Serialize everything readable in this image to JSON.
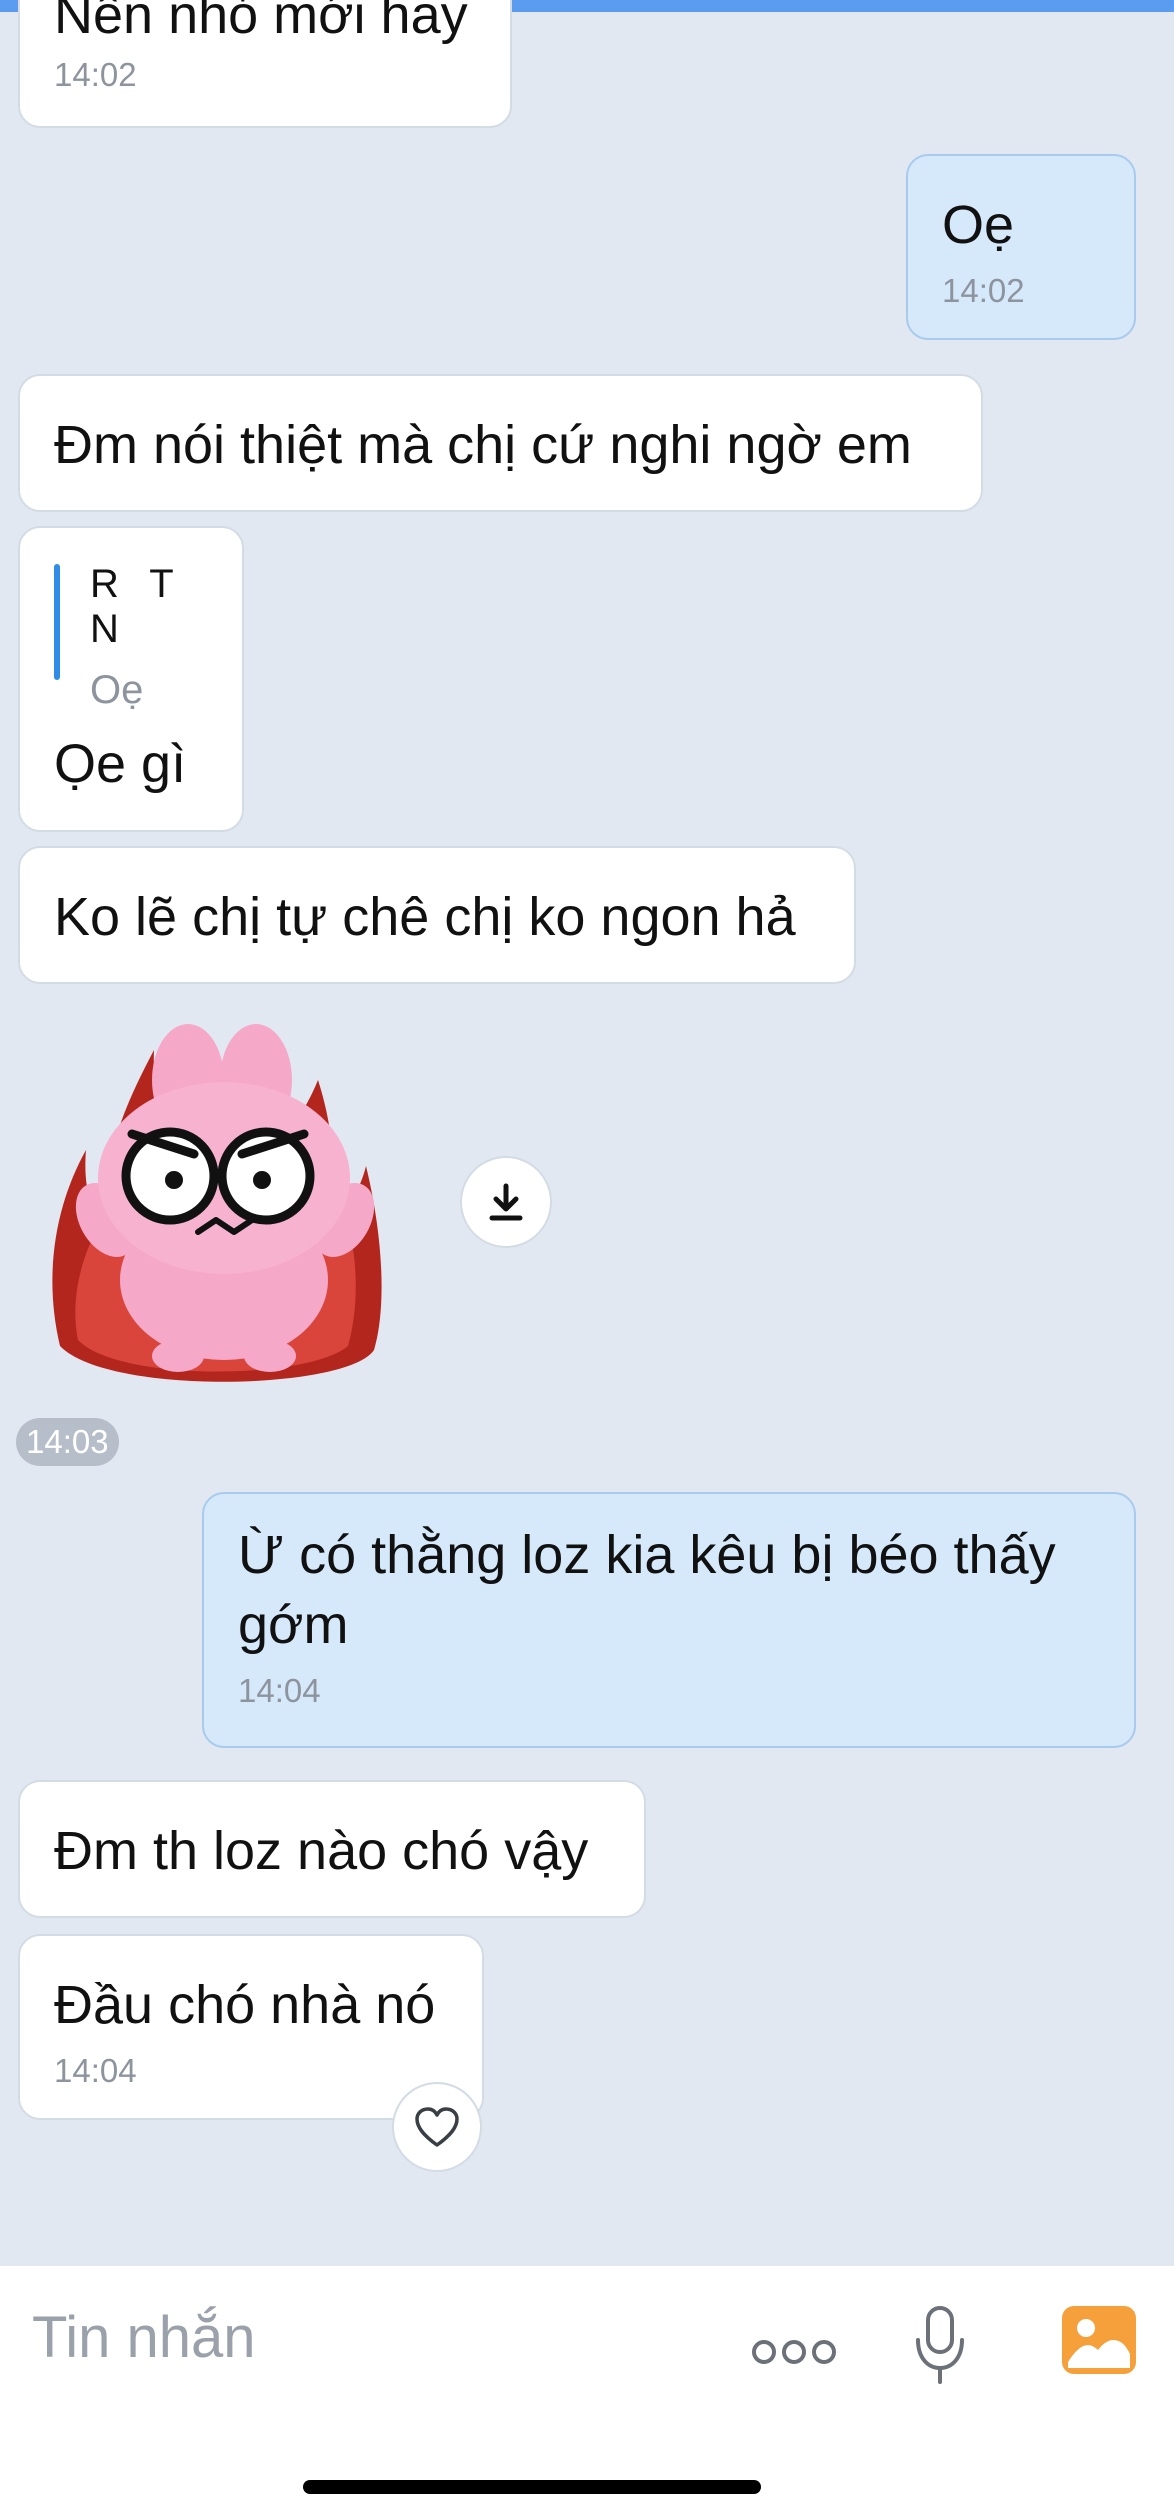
{
  "messages": [
    {
      "text": "Nên nhỏ mới hay",
      "time": "14:02"
    },
    {
      "text": "Oẹ",
      "time": "14:02"
    },
    {
      "text": "Đm nói thiệt mà chị cứ nghi ngờ em"
    },
    {
      "reply_author": "R T N",
      "reply_text": "Oẹ",
      "text": "Ọe gì"
    },
    {
      "text": "Ko lẽ chị tự chê chị ko ngon hả"
    },
    {
      "time": "14:03"
    },
    {
      "text": "Ừ có thằng loz kia kêu bị béo thấy\ngớm",
      "time": "14:04"
    },
    {
      "text": "Đm th loz nào chó vậy"
    },
    {
      "text": "Đầu chó nhà nó",
      "time": "14:04"
    }
  ],
  "input": {
    "placeholder": "Tin nhắn"
  },
  "icons": {
    "download": "download-icon",
    "reaction": "heart-icon",
    "more": "more-options-icon",
    "mic": "microphone-icon",
    "gallery": "gallery-icon"
  },
  "colors": {
    "accent": "#2f8de8",
    "my_bubble": "#d5e9fb",
    "gallery": "#f5a03a"
  }
}
